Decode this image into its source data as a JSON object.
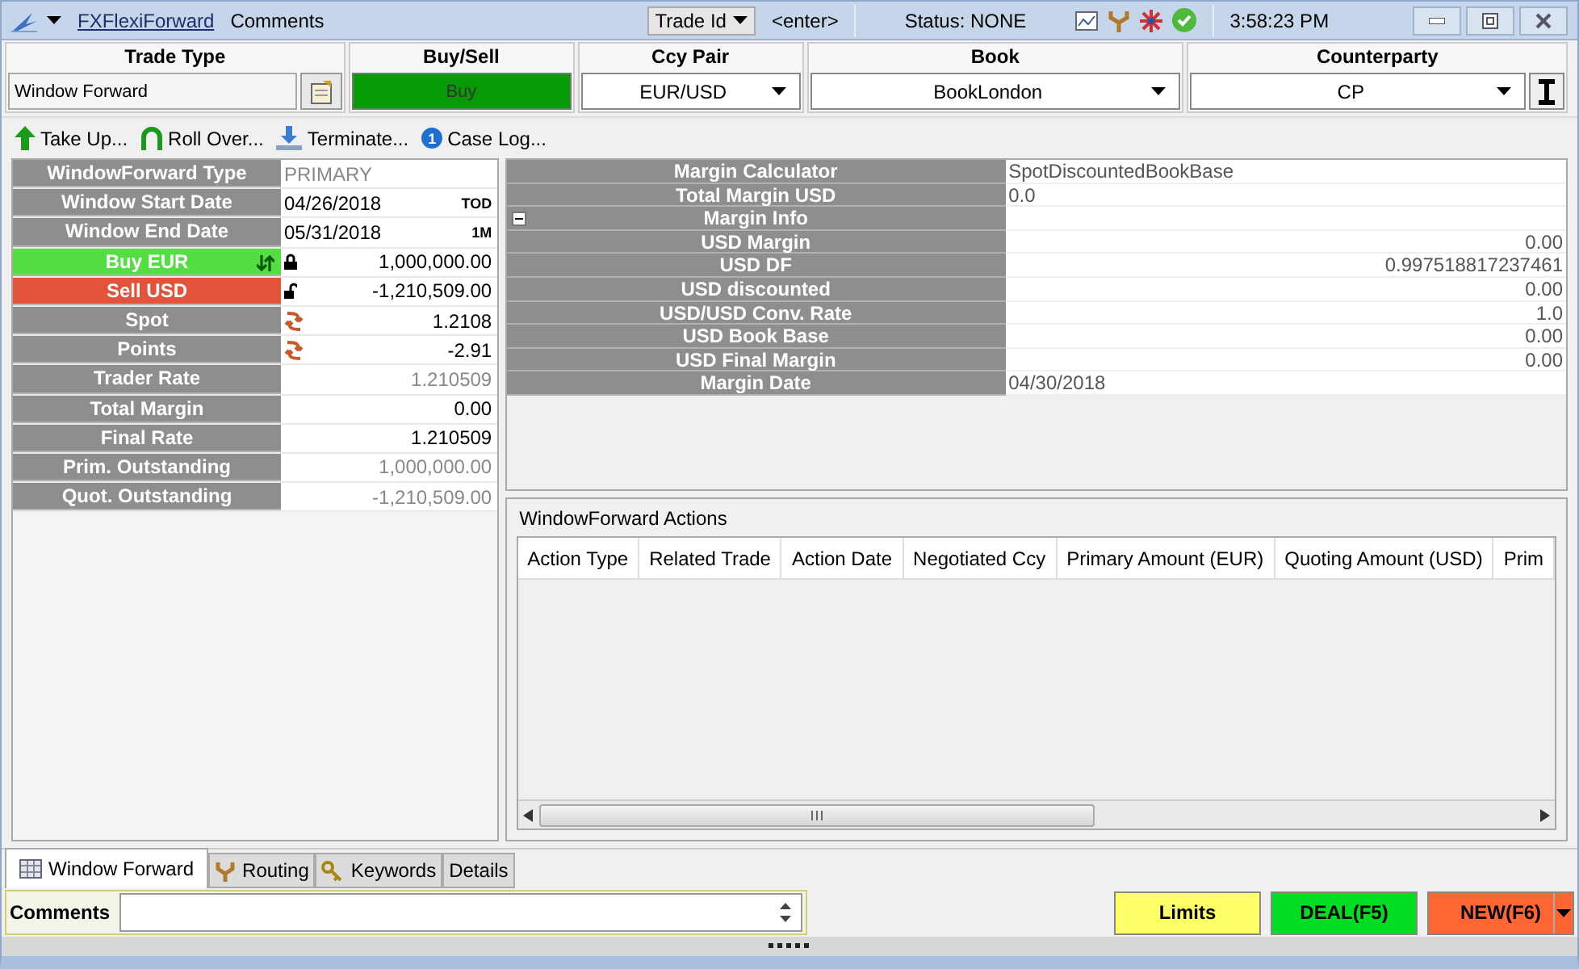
{
  "titlebar": {
    "app_link": "FXFlexiForward",
    "comments_label": "Comments",
    "trade_id_dropdown": "Trade Id",
    "trade_id_value": "<enter>",
    "status": "Status: NONE",
    "time": "3:58:23 PM"
  },
  "header_fields": [
    {
      "label": "Trade Type",
      "kind": "text",
      "value": "Window Forward"
    },
    {
      "label": "Buy/Sell",
      "kind": "buysell",
      "value": "Buy"
    },
    {
      "label": "Ccy Pair",
      "kind": "dropdown",
      "value": "EUR/USD"
    },
    {
      "label": "Book",
      "kind": "dropdown",
      "value": "BookLondon"
    },
    {
      "label": "Counterparty",
      "kind": "lookup",
      "value": "CP"
    }
  ],
  "toolbar": [
    {
      "kind": "take_up",
      "label": "Take Up..."
    },
    {
      "kind": "roll_over",
      "label": "Roll Over..."
    },
    {
      "kind": "terminate",
      "label": "Terminate..."
    },
    {
      "kind": "case_log",
      "label": "Case Log...",
      "badge": "1"
    }
  ],
  "trade_grid": [
    {
      "label": "WindowForward Type",
      "kind": "plain",
      "value": "PRIMARY",
      "disabled": true
    },
    {
      "label": "Window Start Date",
      "kind": "date",
      "value": "04/26/2018",
      "tenor": "TOD",
      "disabled": false
    },
    {
      "label": "Window End Date",
      "kind": "date",
      "value": "05/31/2018",
      "tenor": "1M",
      "disabled": false
    },
    {
      "label": "Buy EUR",
      "kind": "buy",
      "value": "1,000,000.00",
      "locked": true,
      "disabled": false
    },
    {
      "label": "Sell USD",
      "kind": "sell",
      "value": "-1,210,509.00",
      "locked": false,
      "disabled": false
    },
    {
      "label": "Spot",
      "kind": "rate",
      "value": "1.2108",
      "disabled": false
    },
    {
      "label": "Points",
      "kind": "rate",
      "value": "-2.91",
      "disabled": false
    },
    {
      "label": "Trader Rate",
      "kind": "number",
      "value": "1.210509",
      "disabled": true
    },
    {
      "label": "Total Margin",
      "kind": "number",
      "value": "0.00",
      "disabled": false
    },
    {
      "label": "Final Rate",
      "kind": "number",
      "value": "1.210509",
      "disabled": false
    },
    {
      "label": "Prim. Outstanding",
      "kind": "number",
      "value": "1,000,000.00",
      "disabled": true
    },
    {
      "label": "Quot. Outstanding",
      "kind": "number",
      "value": "-1,210,509.00",
      "disabled": true
    }
  ],
  "margin_grid": [
    {
      "label": "Margin Calculator",
      "value": "SpotDiscountedBookBase"
    },
    {
      "label": "Total Margin USD",
      "value": "0.0"
    },
    {
      "label": "Margin Info",
      "expanded": true,
      "children": [
        {
          "label": "USD Margin",
          "value": "0.00"
        },
        {
          "label": "USD DF",
          "value": "0.997518817237461"
        },
        {
          "label": "USD discounted",
          "value": "0.00"
        },
        {
          "label": "USD/USD Conv. Rate",
          "value": "1.0"
        },
        {
          "label": "USD Book Base",
          "value": "0.00"
        },
        {
          "label": "USD Final Margin",
          "value": "0.00"
        }
      ]
    },
    {
      "label": "Margin Date",
      "value": "04/30/2018"
    }
  ],
  "actions": {
    "title": "WindowForward Actions",
    "columns": [
      "Action Type",
      "Related Trade",
      "Action Date",
      "Negotiated Ccy",
      "Primary Amount (EUR)",
      "Quoting Amount (USD)",
      "Prim"
    ]
  },
  "tabs": [
    {
      "kind": "window_forward",
      "label": "Window Forward",
      "selected": true
    },
    {
      "kind": "routing",
      "label": "Routing",
      "selected": false
    },
    {
      "kind": "keywords",
      "label": "Keywords",
      "selected": false
    },
    {
      "kind": "details",
      "label": "Details",
      "selected": false
    }
  ],
  "comments": {
    "label": "Comments"
  },
  "buttons": [
    {
      "label": "Limits",
      "color": "#ffff66",
      "menu": false
    },
    {
      "label": "DEAL(F5)",
      "color": "#00dd22",
      "menu": false
    },
    {
      "label": "NEW(F6)",
      "color": "#ff6633",
      "menu": true
    }
  ]
}
